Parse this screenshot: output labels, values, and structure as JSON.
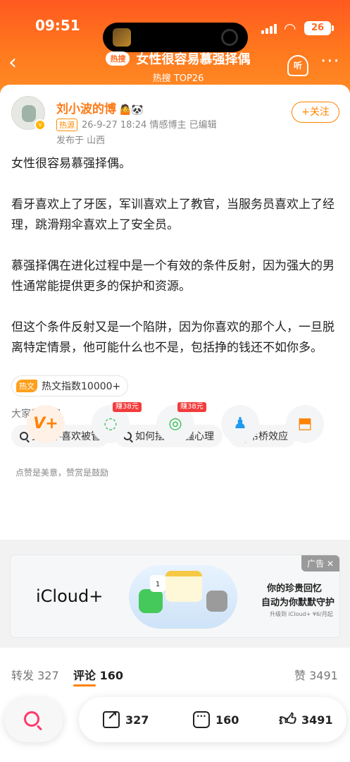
{
  "status": {
    "time": "09:51",
    "battery": "26"
  },
  "nav": {
    "hot_badge": "热搜",
    "title": "女性很容易慕强择偶",
    "subtitle": "热搜 TOP26",
    "listen_label": "听"
  },
  "post": {
    "author": "刘小波的博",
    "author_emoji": "🤷🐼",
    "source_tag": "热源",
    "meta": "26-9-27 18:24  情感博主  已编辑",
    "location": "发布于 山西",
    "follow_label": "+关注",
    "paragraphs": [
      "女性很容易慕强择偶。",
      "看牙喜欢上了牙医，军训喜欢上了教官，当服务员喜欢上了经理，跳滑翔伞喜欢上了安全员。",
      "慕强择偶在进化过程中是一个有效的条件反射，因为强大的男性通常能提供更多的保护和资源。",
      "但这个条件反射又是一个陷阱，因为你喜欢的那个人，一旦脱离特定情景，他可能什么也不是，包括挣的钱还不如你多。"
    ],
    "hot_index_tag": "热文",
    "hot_index": "热文指数10000+",
    "also_search_label": "大家都在搜",
    "search_chips": [
      "女生不喜欢被管",
      "如何摆脱慕强心理",
      "吊桥效应"
    ],
    "like_hint": "点赞是美意，赞赏是鼓励"
  },
  "share": {
    "items": [
      {
        "name": "v-plus",
        "glyph": "V+",
        "color": "#ff8200",
        "reward": ""
      },
      {
        "name": "wechat",
        "glyph": "◌",
        "color": "#2bbd4a",
        "reward": "赚38元"
      },
      {
        "name": "moments",
        "glyph": "◎",
        "color": "#2bbd4a",
        "reward": "赚38元"
      },
      {
        "name": "qq",
        "glyph": "♟",
        "color": "#1e9bf0",
        "reward": ""
      },
      {
        "name": "save-image",
        "glyph": "⬒",
        "color": "#ff8200",
        "reward": ""
      }
    ]
  },
  "ad": {
    "label": "广告 ✕",
    "brand": "iCloud+",
    "calendar_day": "1",
    "headline1": "你的珍贵回忆",
    "headline2": "自动为你默默守护",
    "fine_print": "升级到 iCloud+ ¥6/月起"
  },
  "tabs": {
    "repost": "转发 327",
    "comment": "评论 160",
    "likes": "赞 3491"
  },
  "toolbar": {
    "share_count": "327",
    "comment_count": "160",
    "like_count": "3491"
  }
}
